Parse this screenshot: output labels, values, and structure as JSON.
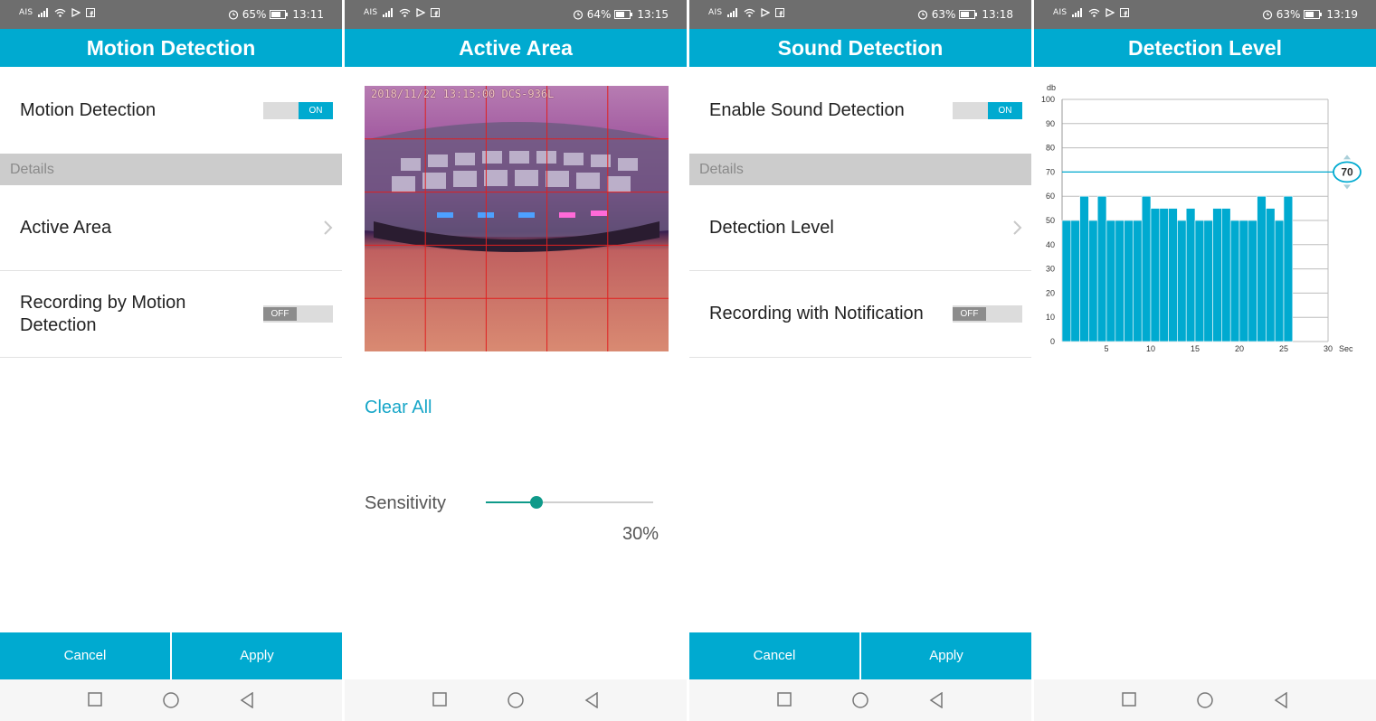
{
  "status": [
    {
      "carrier": "AIS",
      "battery": "65%",
      "time": "13:11",
      "battery_level": 0.65
    },
    {
      "carrier": "AIS",
      "battery": "64%",
      "time": "13:15",
      "battery_level": 0.64
    },
    {
      "carrier": "AIS",
      "battery": "63%",
      "time": "13:18",
      "battery_level": 0.63
    },
    {
      "carrier": "AIS",
      "battery": "63%",
      "time": "13:19",
      "battery_level": 0.63
    }
  ],
  "motion": {
    "title": "Motion Detection",
    "motion_label": "Motion Detection",
    "motion_toggle": "ON",
    "details_header": "Details",
    "active_area_label": "Active Area",
    "recording_label_line1": "Recording by Motion",
    "recording_label_line2": "Detection",
    "recording_toggle": "OFF",
    "cancel": "Cancel",
    "apply": "Apply"
  },
  "active": {
    "title": "Active Area",
    "timestamp": "2018/11/22 13:15:00 DCS-936L",
    "clear_all": "Clear All",
    "sensitivity_label": "Sensitivity",
    "sensitivity_value": "30%",
    "sensitivity_level": 0.3
  },
  "sound": {
    "title": "Sound Detection",
    "enable_label": "Enable Sound Detection",
    "enable_toggle": "ON",
    "details_header": "Details",
    "level_label": "Detection Level",
    "recording_label": "Recording with Notification",
    "recording_toggle": "OFF",
    "cancel": "Cancel",
    "apply": "Apply"
  },
  "level": {
    "title": "Detection Level",
    "threshold_badge": "70"
  },
  "colors": {
    "accent": "#00aad0",
    "statusbar": "#6e6e6e",
    "slider": "#0f9a8a",
    "grid_red": "#e02020"
  },
  "icons": [
    "signal-icon",
    "wifi-icon",
    "cast-icon",
    "facebook-icon",
    "alarm-icon",
    "battery-icon",
    "chevron-right-icon",
    "square-icon",
    "circle-icon",
    "back-triangle-icon"
  ],
  "chart_data": {
    "type": "bar",
    "ylabel": "db",
    "xlabel": "Sec",
    "ylim": [
      0,
      100
    ],
    "xlim": [
      0,
      30
    ],
    "yticks": [
      0,
      10,
      20,
      30,
      40,
      50,
      60,
      70,
      80,
      90,
      100
    ],
    "xticks": [
      5,
      10,
      15,
      20,
      25,
      30
    ],
    "threshold": 70,
    "x": [
      1,
      2,
      3,
      4,
      5,
      6,
      7,
      8,
      9,
      10,
      11,
      12,
      13,
      14,
      15,
      16,
      17,
      18,
      19,
      20,
      21,
      22,
      23,
      24,
      25,
      26
    ],
    "values": [
      50,
      50,
      60,
      50,
      60,
      50,
      50,
      50,
      50,
      60,
      55,
      55,
      55,
      50,
      55,
      50,
      50,
      55,
      55,
      50,
      50,
      50,
      60,
      55,
      50,
      60
    ]
  }
}
